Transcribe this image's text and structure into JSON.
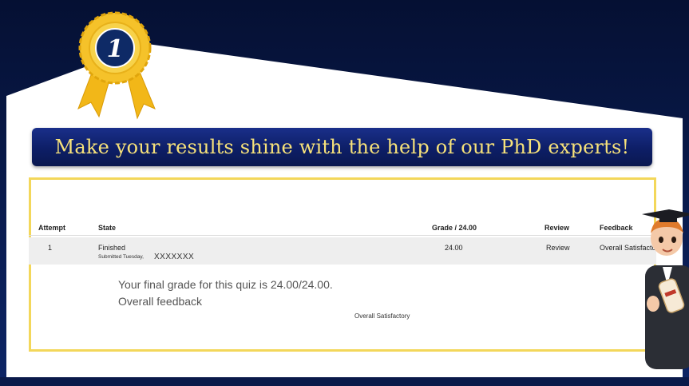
{
  "banner": {
    "headline": "Make your results shine with the help of our PhD experts!"
  },
  "badge": {
    "number": "1",
    "icon": "award-ribbon-icon"
  },
  "table": {
    "headers": {
      "attempt": "Attempt",
      "state": "State",
      "grade": "Grade / 24.00",
      "review": "Review",
      "feedback": "Feedback"
    },
    "rows": [
      {
        "attempt": "1",
        "state": "Finished",
        "submitted": "Submitted Tuesday,",
        "masked": "XXXXXXX",
        "grade": "24.00",
        "review": "Review",
        "feedback": "Overall Satisfactory"
      }
    ]
  },
  "summary": {
    "final_grade": "Your final grade for this quiz is 24.00/24.00.",
    "overall_feedback_label": "Overall feedback",
    "overall_feedback_value": "Overall Satisfactory"
  },
  "colors": {
    "navy": "#0a1a4a",
    "banner": "#0d1e66",
    "banner_text": "#f7e27a",
    "gold": "#f3d75a"
  },
  "mascot": {
    "icon": "graduate-mascot-icon"
  }
}
